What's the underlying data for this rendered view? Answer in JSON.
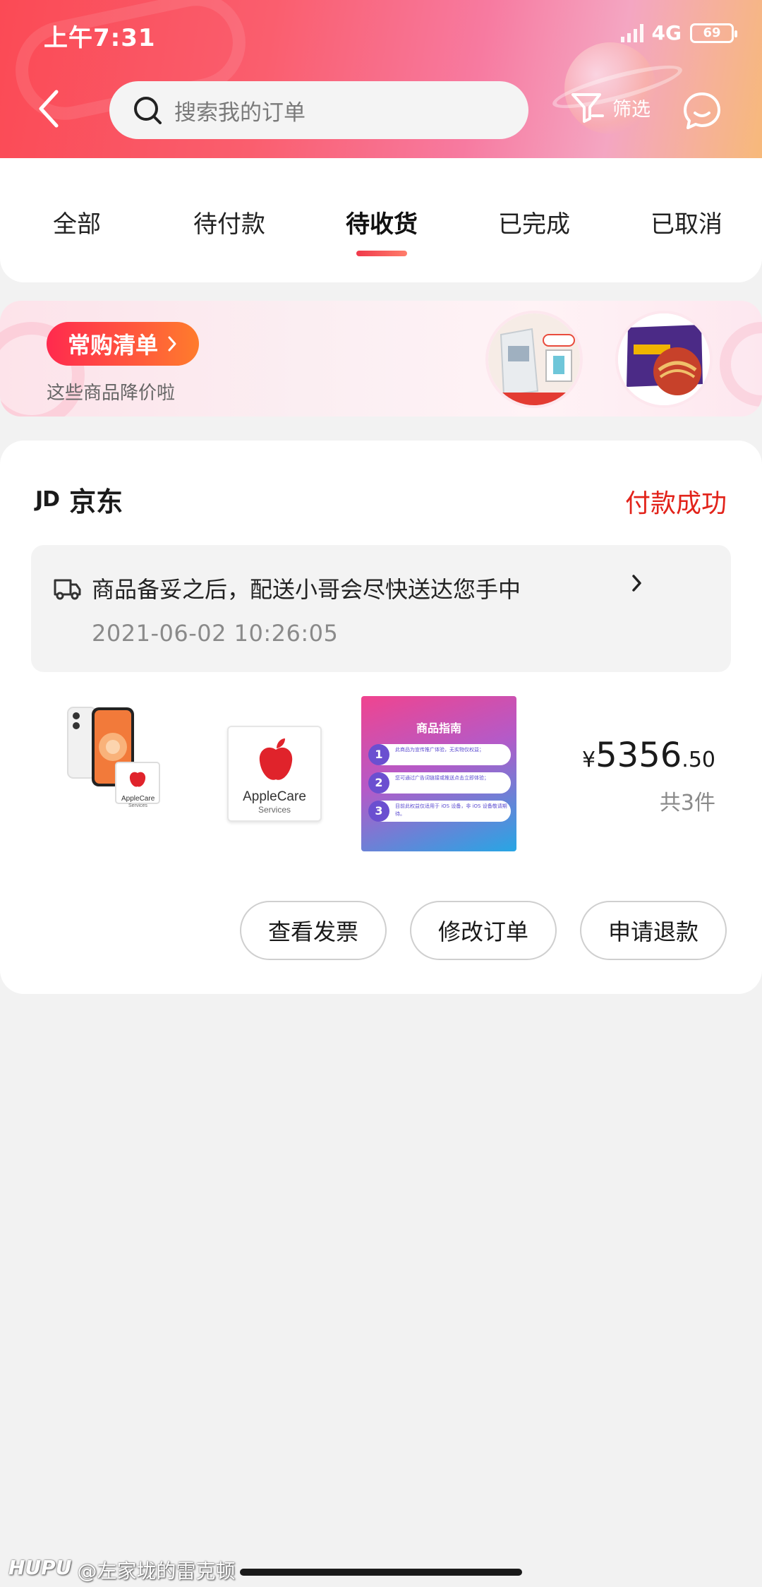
{
  "status_bar": {
    "time": "上午7:31",
    "network": "4G",
    "battery": "69"
  },
  "header": {
    "search_placeholder": "搜索我的订单",
    "filter_label": "筛选"
  },
  "tabs": [
    {
      "label": "全部",
      "active": false
    },
    {
      "label": "待付款",
      "active": false
    },
    {
      "label": "待收货",
      "active": true
    },
    {
      "label": "已完成",
      "active": false
    },
    {
      "label": "已取消",
      "active": false
    }
  ],
  "banner": {
    "title": "常购清单",
    "subtitle": "这些商品降价啦"
  },
  "order": {
    "shop_logo": "JD",
    "shop_name": "京东",
    "status": "付款成功",
    "shipping_message": "商品备妥之后，配送小哥会尽快送达您手中",
    "shipping_time": "2021-06-02 10:26:05",
    "products": [
      {
        "name": "iPhone 12 + AppleCare",
        "badge": "AppleCare",
        "badge_sub": "Services"
      },
      {
        "name": "AppleCare Services",
        "brand": "AppleCare",
        "sub": "Services"
      },
      {
        "name": "商品指南",
        "title": "商品指南",
        "notes": [
          "此商品为宣传推广体验，无实物仅权益；",
          "您可通过广告词链接或推送点击立即体验；",
          "目前此权益仅适用于 iOS 设备，非 iOS 设备敬请期待。"
        ]
      }
    ],
    "price_currency": "¥",
    "price_int": "5356",
    "price_dec": ".50",
    "item_count": "共3件",
    "actions": [
      "查看发票",
      "修改订单",
      "申请退款"
    ]
  },
  "watermark": {
    "brand": "HUPU",
    "user": "@左家垅的雷克顿"
  },
  "colors": {
    "accent": "#e2231a",
    "header_start": "#fb4a55",
    "header_end": "#f7b97a"
  }
}
